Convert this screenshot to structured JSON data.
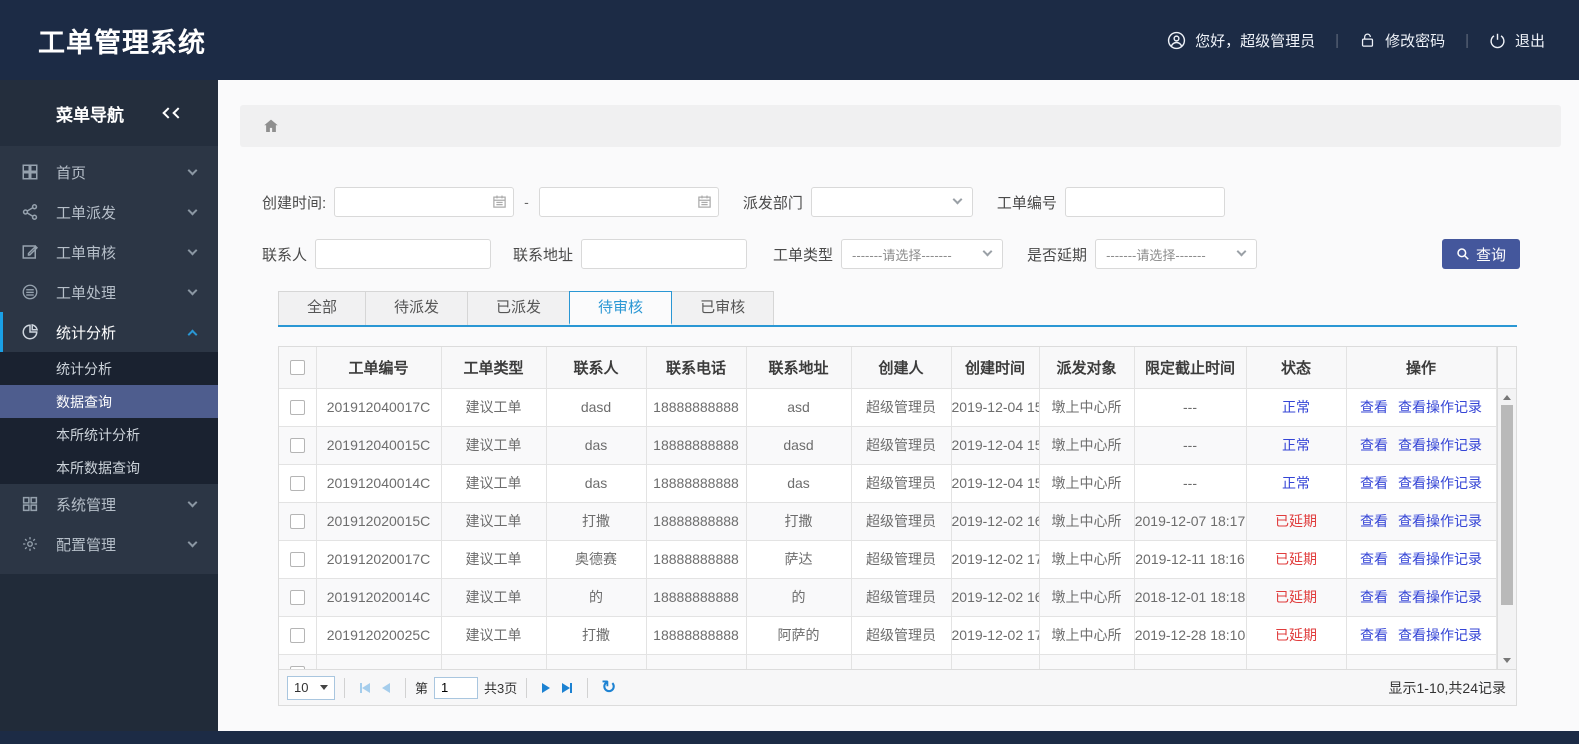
{
  "header": {
    "title": "工单管理系统",
    "greeting": "您好，超级管理员",
    "change_password": "修改密码",
    "logout": "退出"
  },
  "sidebar": {
    "title": "菜单导航",
    "items": [
      {
        "label": "首页",
        "icon": "dashboard-icon"
      },
      {
        "label": "工单派发",
        "icon": "share-icon"
      },
      {
        "label": "工单审核",
        "icon": "edit-icon"
      },
      {
        "label": "工单处理",
        "icon": "process-icon"
      },
      {
        "label": "统计分析",
        "icon": "pie-chart-icon",
        "active": true,
        "expanded": true,
        "children": [
          "统计分析",
          "数据查询",
          "本所统计分析",
          "本所数据查询"
        ],
        "selected_child": "数据查询"
      },
      {
        "label": "系统管理",
        "icon": "system-icon"
      },
      {
        "label": "配置管理",
        "icon": "gear-icon"
      }
    ]
  },
  "filters": {
    "create_time_label": "创建时间:",
    "date_separator": "-",
    "dispatch_dept_label": "派发部门",
    "order_no_label": "工单编号",
    "contact_label": "联系人",
    "address_label": "联系地址",
    "order_type_label": "工单类型",
    "delay_label": "是否延期",
    "select_placeholder": "-------请选择-------",
    "search_button": "查询"
  },
  "tabs": [
    {
      "label": "全部"
    },
    {
      "label": "待派发"
    },
    {
      "label": "已派发"
    },
    {
      "label": "待审核",
      "active": true
    },
    {
      "label": "已审核"
    }
  ],
  "table": {
    "columns": [
      "工单编号",
      "工单类型",
      "联系人",
      "联系电话",
      "联系地址",
      "创建人",
      "创建时间",
      "派发对象",
      "限定截止时间",
      "状态",
      "操作"
    ],
    "action_labels": [
      "查看",
      "查看操作记录"
    ],
    "rows": [
      {
        "order_no": "201912040017C",
        "type": "建议工单",
        "contact": "dasd",
        "phone": "18888888888",
        "address": "asd",
        "creator": "超级管理员",
        "created": "2019-12-04 15",
        "target": "墩上中心所",
        "deadline": "---",
        "status": "正常",
        "status_type": "normal"
      },
      {
        "order_no": "201912040015C",
        "type": "建议工单",
        "contact": "das",
        "phone": "18888888888",
        "address": "dasd",
        "creator": "超级管理员",
        "created": "2019-12-04 15",
        "target": "墩上中心所",
        "deadline": "---",
        "status": "正常",
        "status_type": "normal"
      },
      {
        "order_no": "201912040014C",
        "type": "建议工单",
        "contact": "das",
        "phone": "18888888888",
        "address": "das",
        "creator": "超级管理员",
        "created": "2019-12-04 15",
        "target": "墩上中心所",
        "deadline": "---",
        "status": "正常",
        "status_type": "normal"
      },
      {
        "order_no": "201912020015C",
        "type": "建议工单",
        "contact": "打撒",
        "phone": "18888888888",
        "address": "打撒",
        "creator": "超级管理员",
        "created": "2019-12-02 16",
        "target": "墩上中心所",
        "deadline": "2019-12-07 18:17",
        "status": "已延期",
        "status_type": "delayed"
      },
      {
        "order_no": "201912020017C",
        "type": "建议工单",
        "contact": "奥德赛",
        "phone": "18888888888",
        "address": "萨达",
        "creator": "超级管理员",
        "created": "2019-12-02 17",
        "target": "墩上中心所",
        "deadline": "2019-12-11 18:16",
        "status": "已延期",
        "status_type": "delayed"
      },
      {
        "order_no": "201912020014C",
        "type": "建议工单",
        "contact": "的",
        "phone": "18888888888",
        "address": "的",
        "creator": "超级管理员",
        "created": "2019-12-02 16",
        "target": "墩上中心所",
        "deadline": "2018-12-01 18:18",
        "status": "已延期",
        "status_type": "delayed"
      },
      {
        "order_no": "201912020025C",
        "type": "建议工单",
        "contact": "打撒",
        "phone": "18888888888",
        "address": "阿萨的",
        "creator": "超级管理员",
        "created": "2019-12-02 17",
        "target": "墩上中心所",
        "deadline": "2019-12-28 18:10",
        "status": "已延期",
        "status_type": "delayed"
      },
      {
        "order_no": "",
        "type": "",
        "contact": "",
        "phone": "",
        "address": "",
        "creator": "",
        "created": "",
        "target": "",
        "deadline": "",
        "status": "",
        "status_type": ""
      }
    ]
  },
  "pagination": {
    "page_size": "10",
    "page_prefix": "第",
    "current_page": "1",
    "total_pages": "共3页",
    "summary": "显示1-10,共24记录"
  },
  "colors": {
    "header_bg": "#1c2b45",
    "sidebar_bg": "#2c3645",
    "sidebar_selected_bg": "#4e5d8e",
    "accent_blue": "#2a97d4",
    "link_blue": "#3545d6",
    "status_normal": "#3545d6",
    "status_delayed": "#e03c3c",
    "search_button_bg": "#44579c"
  }
}
